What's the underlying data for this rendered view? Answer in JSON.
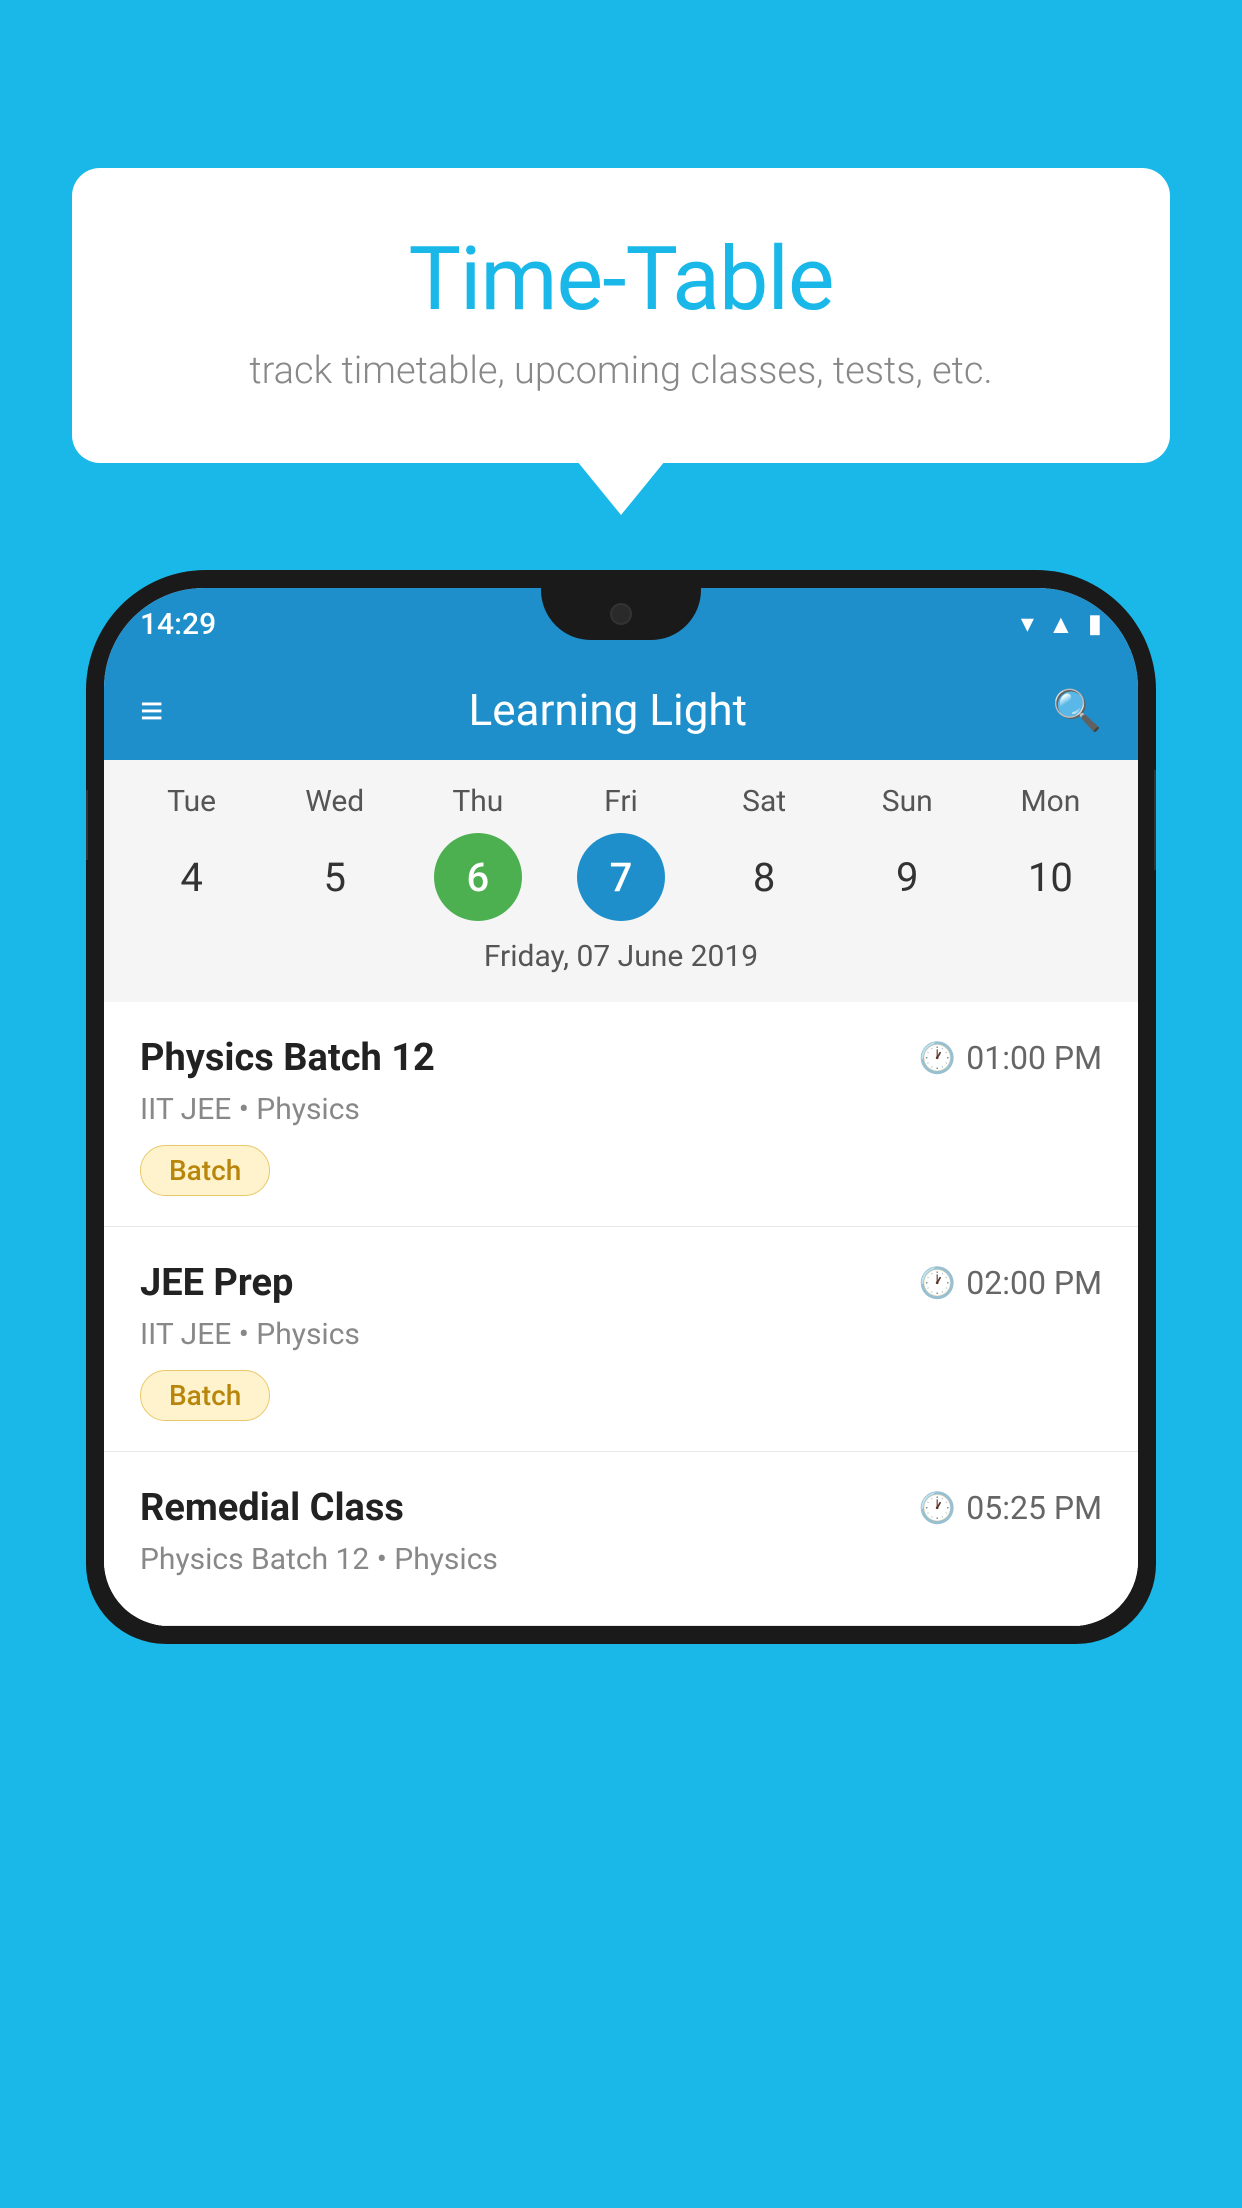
{
  "background_color": "#1ab8e8",
  "speech_bubble": {
    "title": "Time-Table",
    "subtitle": "track timetable, upcoming classes, tests, etc."
  },
  "phone": {
    "status_bar": {
      "time": "14:29"
    },
    "app_header": {
      "title": "Learning Light"
    },
    "calendar": {
      "days": [
        {
          "label": "Tue",
          "number": "4",
          "state": "normal"
        },
        {
          "label": "Wed",
          "number": "5",
          "state": "normal"
        },
        {
          "label": "Thu",
          "number": "6",
          "state": "today"
        },
        {
          "label": "Fri",
          "number": "7",
          "state": "selected"
        },
        {
          "label": "Sat",
          "number": "8",
          "state": "normal"
        },
        {
          "label": "Sun",
          "number": "9",
          "state": "normal"
        },
        {
          "label": "Mon",
          "number": "10",
          "state": "normal"
        }
      ],
      "selected_date_label": "Friday, 07 June 2019"
    },
    "schedule": [
      {
        "title": "Physics Batch 12",
        "time": "01:00 PM",
        "detail": "IIT JEE • Physics",
        "badge": "Batch"
      },
      {
        "title": "JEE Prep",
        "time": "02:00 PM",
        "detail": "IIT JEE • Physics",
        "badge": "Batch"
      },
      {
        "title": "Remedial Class",
        "time": "05:25 PM",
        "detail": "Physics Batch 12 • Physics",
        "badge": null
      }
    ]
  }
}
